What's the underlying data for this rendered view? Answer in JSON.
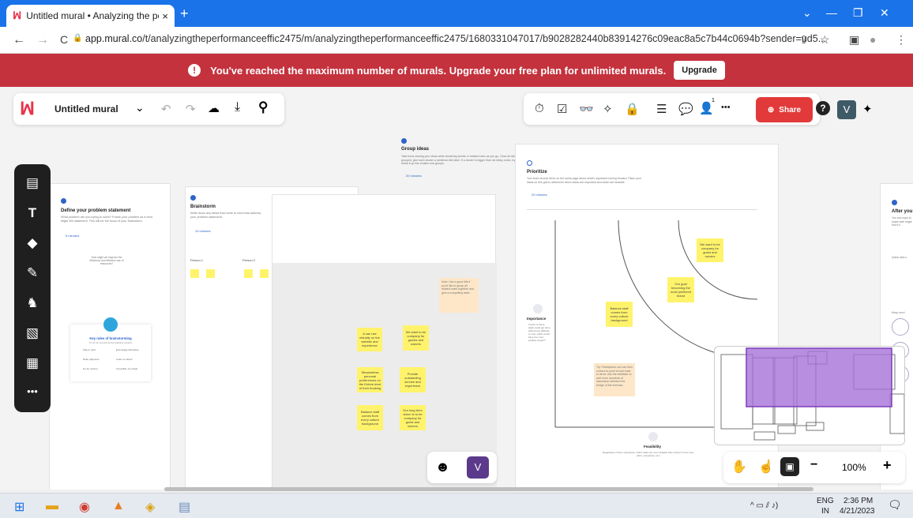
{
  "browser": {
    "tab_title": "Untitled mural • Analyzing the pe",
    "tab_close": "×",
    "new_tab": "+",
    "favicon": "ꟽ",
    "url_host": "app.mural.co",
    "url_path": "/t/analyzingtheperformanceeffic2475/m/analyzingtheperformanceeffic2475/1680331047017/b9028282440b83914276c09eac8a5c7b44c0694b?sender=ud5...",
    "back": "←",
    "forward": "→",
    "reload": "C",
    "lock": "🔒",
    "share_icon": "⇪",
    "star_icon": "☆",
    "sidebar_icon": "▣",
    "profile_icon": "●",
    "menu_icon": "⋮",
    "win_min": "—",
    "win_restore": "❐",
    "win_close": "✕",
    "win_chevron": "⌄"
  },
  "banner": {
    "icon": "!",
    "message": "You've reached the maximum number of murals. Upgrade your free plan for unlimited murals.",
    "upgrade_label": "Upgrade"
  },
  "toolbar": {
    "logo": "ꟽ",
    "mural_title": "Untitled mural",
    "title_chevron": "⌄",
    "undo": "↶",
    "redo": "↷",
    "cloud": "☁",
    "download": "⤓",
    "search": "⚲",
    "share_label": "Share",
    "help": "?",
    "user_initial": "V",
    "sparkle": "✦",
    "more": "•••",
    "notif_count": "1"
  },
  "left_tools": [
    "sticky-note",
    "text",
    "shapes",
    "pen",
    "llama",
    "image",
    "templates",
    "more"
  ],
  "canvas": {
    "define": {
      "title": "Define your problem statement",
      "body": "What problem are you trying to solve? Frame your problem as a How Might We statement. This will be the focus of your brainstorm.",
      "time": "5 minutes",
      "note_text": "How might we improve the efficiency and effective use of resources?"
    },
    "rules": {
      "title": "Key rules of brainstorming",
      "sub": "To run an smooth and productive session",
      "items": [
        "Stay in topic",
        "Encourage wild ideas",
        "Defer judgment",
        "Listen to others",
        "Go for volume",
        "If possible, be visual"
      ]
    },
    "brainstorm": {
      "title": "Brainstorm",
      "body": "Write down any ideas that come to mind that address your problem statement.",
      "time": "10 minutes",
      "person1": "Person 1",
      "person2": "Person 2"
    },
    "group": {
      "title": "Group ideas",
      "body": "Take turns sharing your ideas while clustering similar or related notes as you go. Once all sticky notes have been grouped, give each cluster a sentence-like label. If a cluster is bigger than six sticky notes, try and see if you and break it up into smaller sub-groups.",
      "time": "20 minutes"
    },
    "prioritize": {
      "title": "Prioritize",
      "body": "Your team should all be on the same page about what's important moving forward. Place your ideas on this grid to determine which ideas are important and which are feasible.",
      "time": "20 minutes",
      "importance": "Importance",
      "importance_body": "If each of these tasks could get done without any difficulty or cost, which would have the most positive impact?",
      "feasibility": "Feasibility",
      "feasibility_body": "Regardless of their importance, which tasks are more feasible than others? (Cost, time, effort, complexity, etc.)"
    },
    "after": {
      "title": "After you",
      "body": "You can expo to share with might find it h",
      "quick": "Quick add-o",
      "keep": "Keep movi"
    },
    "group_stickies": [
      "A can use virtually on the website and experience",
      "We want to be company for guests and owners",
      "Steward/ess personal preferences on the Entree level of their booking",
      "Provide outstanding service and experience",
      "Balance staff comes from every culture background",
      "Our long term vision is to be company for guest and owners"
    ],
    "group_note": "Note: Use a good title if you'd like to group all related notes together and give a compelling label.",
    "prio_stickies": [
      "We want to be company for guest and owners",
      "Our goal becoming the most preferred brand",
      "Balance staff comes from every culture background"
    ],
    "prio_note": "Tip: Participants can use their cursors to point at and react to items. Ask the facilitator to add more moments of discussion between the bridge of the exercise."
  },
  "bottom": {
    "emoji": "☻",
    "user_initial": "V",
    "hand": "✋",
    "pointer": "☝",
    "zoom_out": "−",
    "zoom_level": "100%",
    "zoom_in": "+"
  },
  "taskbar": {
    "start": "⊞",
    "lang_top": "ENG",
    "lang_bottom": "IN",
    "time": "2:36 PM",
    "date": "4/21/2023",
    "tray_icons": "^ ▭ ⫽ ♪)",
    "notif": "🗨"
  },
  "colors": {
    "chrome": "#1a73e8",
    "banner": "#c4323d",
    "share": "#e23a3a",
    "sticky": "#fff36b",
    "minimap_view": "#a672d9"
  }
}
